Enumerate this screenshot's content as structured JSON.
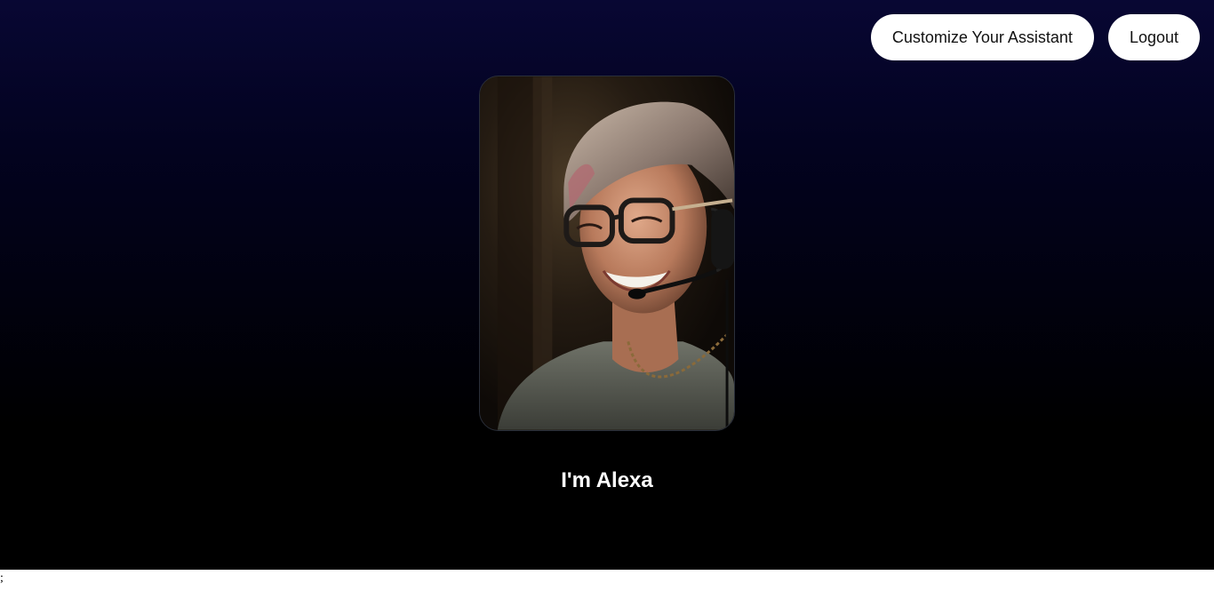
{
  "header": {
    "customize_label": "Customize Your Assistant",
    "logout_label": "Logout"
  },
  "assistant": {
    "name_text": "I'm Alexa"
  },
  "footer": {
    "stray_text": ";"
  },
  "colors": {
    "background_top": "#080733",
    "background_bottom": "#000000",
    "button_bg": "#ffffff",
    "button_text": "#111111",
    "title_text": "#ffffff"
  }
}
